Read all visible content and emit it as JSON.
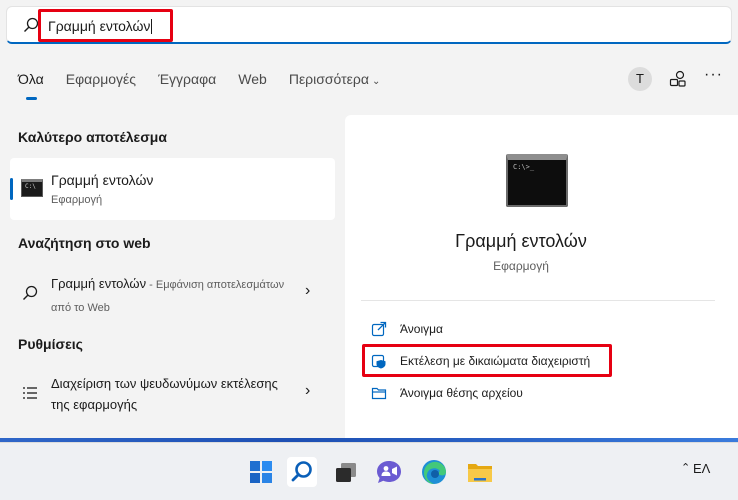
{
  "search": {
    "query": "Γραμμή εντολών"
  },
  "tabs": [
    {
      "label": "Όλα",
      "active": true
    },
    {
      "label": "Εφαρμογές",
      "active": false
    },
    {
      "label": "Έγγραφα",
      "active": false
    },
    {
      "label": "Web",
      "active": false
    },
    {
      "label": "Περισσότερα",
      "active": false
    }
  ],
  "header": {
    "avatar_initial": "T",
    "more_label": "···"
  },
  "best_match": {
    "section_title": "Καλύτερο αποτέλεσμα",
    "name": "Γραμμή εντολών",
    "type": "Εφαρμογή"
  },
  "web_search": {
    "section_title": "Αναζήτηση στο web",
    "query": "Γραμμή εντολών",
    "suffix": " - Εμφάνιση αποτελεσμάτων από το Web"
  },
  "settings": {
    "section_title": "Ρυθμίσεις",
    "item": "Διαχείριση των ψευδωνύμων εκτέλεσης της εφαρμογής"
  },
  "detail": {
    "name": "Γραμμή εντολών",
    "type": "Εφαρμογή",
    "actions": [
      {
        "label": "Άνοιγμα",
        "icon": "open-icon"
      },
      {
        "label": "Εκτέλεση με δικαιώματα διαχειριστή",
        "icon": "admin-shield-icon"
      },
      {
        "label": "Άνοιγμα θέσης αρχείου",
        "icon": "folder-icon"
      }
    ]
  },
  "taskbar": {
    "language": "ΕΛ",
    "icons": [
      "start-icon",
      "search-icon",
      "task-view-icon",
      "teams-chat-icon",
      "edge-icon",
      "file-explorer-icon"
    ]
  },
  "colors": {
    "accent": "#0067c0",
    "highlight": "#e60012"
  }
}
